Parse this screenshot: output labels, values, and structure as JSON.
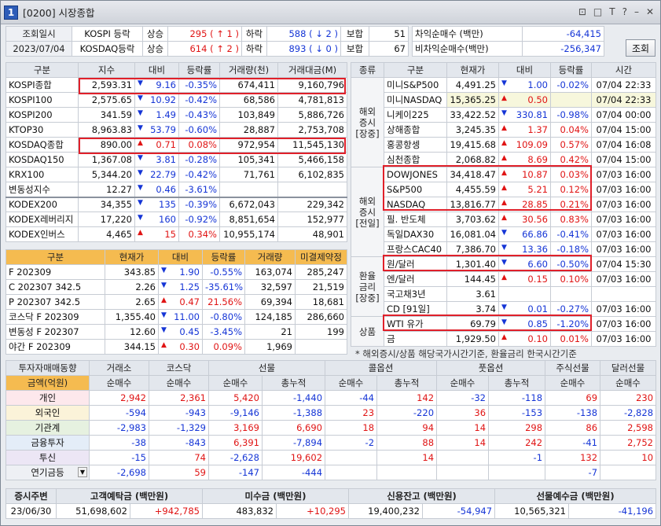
{
  "window": {
    "num": "1",
    "title": "[0200] 시장종합",
    "controls": [
      "⊡",
      "□",
      "T",
      "?",
      "–",
      "✕"
    ]
  },
  "top": {
    "label1": "조회일시",
    "date": "2023/07/04",
    "rows": [
      {
        "name": "KOSPI 등락",
        "up_l": "상승",
        "up_v": "295",
        "up_arrow": "↑",
        "up_n": "1",
        "dn_l": "하락",
        "dn_v": "588",
        "dn_arrow": "↓",
        "dn_n": "2",
        "flat_l": "보합",
        "flat_v": "51"
      },
      {
        "name": "KOSDAQ등락",
        "up_l": "상승",
        "up_v": "614",
        "up_arrow": "↑",
        "up_n": "2",
        "dn_l": "하락",
        "dn_v": "893",
        "dn_arrow": "↓",
        "dn_n": "0",
        "flat_l": "보합",
        "flat_v": "67"
      }
    ],
    "arb": [
      {
        "label": "차익순매수 (백만)",
        "value": "-64,415"
      },
      {
        "label": "비차익순매수(백만)",
        "value": "-256,347"
      }
    ],
    "query_button": "조회"
  },
  "idx": {
    "headers": [
      "구분",
      "지수",
      "대비",
      "등락률",
      "거래량(천)",
      "거래대금(M)"
    ],
    "rows": [
      {
        "n": "KOSPI종합",
        "v": "2,593.31",
        "a": "▼",
        "d": "9.16",
        "p": "-0.35%",
        "q": "674,411",
        "m": "9,160,796",
        "dir": "dn"
      },
      {
        "n": "KOSPI100",
        "v": "2,575.65",
        "a": "▼",
        "d": "10.92",
        "p": "-0.42%",
        "q": "68,586",
        "m": "4,781,813",
        "dir": "dn"
      },
      {
        "n": "KOSPI200",
        "v": "341.59",
        "a": "▼",
        "d": "1.49",
        "p": "-0.43%",
        "q": "103,849",
        "m": "5,886,726",
        "dir": "dn"
      },
      {
        "n": "KTOP30",
        "v": "8,963.83",
        "a": "▼",
        "d": "53.79",
        "p": "-0.60%",
        "q": "28,887",
        "m": "2,753,708",
        "dir": "dn"
      },
      {
        "n": "KOSDAQ종합",
        "v": "890.00",
        "a": "▲",
        "d": "0.71",
        "p": "0.08%",
        "q": "972,954",
        "m": "11,545,130",
        "dir": "up"
      },
      {
        "n": "KOSDAQ150",
        "v": "1,367.08",
        "a": "▼",
        "d": "3.81",
        "p": "-0.28%",
        "q": "105,341",
        "m": "5,466,158",
        "dir": "dn"
      },
      {
        "n": "KRX100",
        "v": "5,344.20",
        "a": "▼",
        "d": "22.79",
        "p": "-0.42%",
        "q": "71,761",
        "m": "6,102,835",
        "dir": "dn"
      },
      {
        "n": "변동성지수",
        "v": "12.27",
        "a": "▼",
        "d": "0.46",
        "p": "-3.61%",
        "q": "",
        "m": "",
        "dir": "dn"
      },
      {
        "n": "KODEX200",
        "v": "34,355",
        "a": "▼",
        "d": "135",
        "p": "-0.39%",
        "q": "6,672,043",
        "m": "229,342",
        "dir": "dn"
      },
      {
        "n": "KODEX레버리지",
        "v": "17,220",
        "a": "▼",
        "d": "160",
        "p": "-0.92%",
        "q": "8,851,654",
        "m": "152,977",
        "dir": "dn"
      },
      {
        "n": "KODEX인버스",
        "v": "4,465",
        "a": "▲",
        "d": "15",
        "p": "0.34%",
        "q": "10,955,174",
        "m": "48,901",
        "dir": "up"
      }
    ]
  },
  "fut": {
    "headers": [
      "구분",
      "현재가",
      "대비",
      "등락률",
      "거래량",
      "미결제약정"
    ],
    "rows": [
      {
        "n": "F 202309",
        "v": "343.85",
        "a": "▼",
        "d": "1.90",
        "p": "-0.55%",
        "q": "163,074",
        "m": "285,247",
        "dir": "dn"
      },
      {
        "n": "C 202307 342.5",
        "v": "2.26",
        "a": "▼",
        "d": "1.25",
        "p": "-35.61%",
        "q": "32,597",
        "m": "21,519",
        "dir": "dn"
      },
      {
        "n": "P 202307 342.5",
        "v": "2.65",
        "a": "▲",
        "d": "0.47",
        "p": "21.56%",
        "q": "69,394",
        "m": "18,681",
        "dir": "up"
      },
      {
        "n": "코스닥 F 202309",
        "v": "1,355.40",
        "a": "▼",
        "d": "11.00",
        "p": "-0.80%",
        "q": "124,185",
        "m": "286,660",
        "dir": "dn"
      },
      {
        "n": "변동성 F 202307",
        "v": "12.60",
        "a": "▼",
        "d": "0.45",
        "p": "-3.45%",
        "q": "21",
        "m": "199",
        "dir": "dn"
      },
      {
        "n": "야간 F 202309",
        "v": "344.15",
        "a": "▲",
        "d": "0.30",
        "p": "0.09%",
        "q": "1,969",
        "m": "",
        "dir": "up"
      }
    ]
  },
  "world": {
    "headers": [
      "종류",
      "구분",
      "현재가",
      "대비",
      "등락률",
      "시간"
    ],
    "groups": [
      {
        "label": "해외\n증시\n[장중]",
        "rows": [
          {
            "n": "미니S&P500",
            "v": "4,491.25",
            "a": "▼",
            "d": "1.00",
            "p": "-0.02%",
            "t": "07/04 22:33",
            "dir": "dn"
          },
          {
            "n": "미니NASDAQ",
            "v": "15,365.25",
            "a": "▲",
            "d": "0.50",
            "p": "",
            "t": "07/04 22:33",
            "dir": "up"
          },
          {
            "n": "니케이225",
            "v": "33,422.52",
            "a": "▼",
            "d": "330.81",
            "p": "-0.98%",
            "t": "07/04 00:00",
            "dir": "dn"
          },
          {
            "n": "상해종합",
            "v": "3,245.35",
            "a": "▲",
            "d": "1.37",
            "p": "0.04%",
            "t": "07/04 15:00",
            "dir": "up"
          },
          {
            "n": "홍콩항셍",
            "v": "19,415.68",
            "a": "▲",
            "d": "109.09",
            "p": "0.57%",
            "t": "07/04 16:08",
            "dir": "up"
          },
          {
            "n": "심천종합",
            "v": "2,068.82",
            "a": "▲",
            "d": "8.69",
            "p": "0.42%",
            "t": "07/04 15:00",
            "dir": "up"
          }
        ]
      },
      {
        "label": "해외\n증시\n[전일]",
        "rows": [
          {
            "n": "DOWJONES",
            "v": "34,418.47",
            "a": "▲",
            "d": "10.87",
            "p": "0.03%",
            "t": "07/03 16:00",
            "dir": "up"
          },
          {
            "n": "S&P500",
            "v": "4,455.59",
            "a": "▲",
            "d": "5.21",
            "p": "0.12%",
            "t": "07/03 16:00",
            "dir": "up"
          },
          {
            "n": "NASDAQ",
            "v": "13,816.77",
            "a": "▲",
            "d": "28.85",
            "p": "0.21%",
            "t": "07/03 16:00",
            "dir": "up"
          },
          {
            "n": "필. 반도체",
            "v": "3,703.62",
            "a": "▲",
            "d": "30.56",
            "p": "0.83%",
            "t": "07/03 16:00",
            "dir": "up"
          },
          {
            "n": "독일DAX30",
            "v": "16,081.04",
            "a": "▼",
            "d": "66.86",
            "p": "-0.41%",
            "t": "07/03 16:00",
            "dir": "dn"
          },
          {
            "n": "프랑스CAC40",
            "v": "7,386.70",
            "a": "▼",
            "d": "13.36",
            "p": "-0.18%",
            "t": "07/03 16:00",
            "dir": "dn"
          }
        ]
      },
      {
        "label": "환율\n금리\n[장중]",
        "rows": [
          {
            "n": "원/달러",
            "v": "1,301.40",
            "a": "▼",
            "d": "6.60",
            "p": "-0.50%",
            "t": "07/04 15:30",
            "dir": "dn"
          },
          {
            "n": "엔/달러",
            "v": "144.45",
            "a": "▲",
            "d": "0.15",
            "p": "0.10%",
            "t": "07/03 16:00",
            "dir": "up"
          },
          {
            "n": "국고채3년",
            "v": "3.61",
            "a": "",
            "d": "",
            "p": "",
            "t": "",
            "dir": "up"
          },
          {
            "n": "CD [91일]",
            "v": "3.74",
            "a": "▼",
            "d": "0.01",
            "p": "-0.27%",
            "t": "07/03 16:00",
            "dir": "dn"
          }
        ]
      },
      {
        "label": "상품",
        "rows": [
          {
            "n": "WTI 유가",
            "v": "69.79",
            "a": "▼",
            "d": "0.85",
            "p": "-1.20%",
            "t": "07/03 16:00",
            "dir": "dn"
          },
          {
            "n": "금",
            "v": "1,929.50",
            "a": "▲",
            "d": "0.10",
            "p": "0.01%",
            "t": "07/03 16:00",
            "dir": "up"
          }
        ]
      }
    ],
    "note": "* 해외증시/상품 해당국가시간기준, 환율금리 한국시간기준"
  },
  "inv": {
    "h1": [
      "투자자매매동향",
      "거래소",
      "코스닥",
      "선물",
      "콜옵션",
      "풋옵션",
      "주식선물",
      "달러선물"
    ],
    "h2": [
      "금액(억원)",
      "순매수",
      "순매수",
      "순매수",
      "총누적",
      "순매수",
      "총누적",
      "순매수",
      "총누적",
      "순매수",
      "순매수"
    ],
    "rows": [
      {
        "n": "개인",
        "v": [
          "2,942",
          "2,361",
          "5,420",
          "-1,440",
          "-44",
          "142",
          "-32",
          "-118",
          "69",
          "230"
        ],
        "d": [
          "up",
          "up",
          "up",
          "bl",
          "bl",
          "up",
          "bl",
          "bl",
          "up",
          "up"
        ]
      },
      {
        "n": "외국인",
        "v": [
          "-594",
          "-943",
          "-9,146",
          "-1,388",
          "23",
          "-220",
          "36",
          "-153",
          "-138",
          "-2,828"
        ],
        "d": [
          "bl",
          "bl",
          "bl",
          "bl",
          "up",
          "bl",
          "up",
          "bl",
          "bl",
          "bl"
        ]
      },
      {
        "n": "기관계",
        "v": [
          "-2,983",
          "-1,329",
          "3,169",
          "6,690",
          "18",
          "94",
          "14",
          "298",
          "86",
          "2,598"
        ],
        "d": [
          "bl",
          "bl",
          "up",
          "up",
          "up",
          "up",
          "up",
          "up",
          "up",
          "up"
        ]
      },
      {
        "n": "금융투자",
        "v": [
          "-38",
          "-843",
          "6,391",
          "-7,894",
          "-2",
          "88",
          "14",
          "242",
          "-41",
          "2,752"
        ],
        "d": [
          "bl",
          "bl",
          "up",
          "bl",
          "bl",
          "up",
          "up",
          "up",
          "bl",
          "up"
        ]
      },
      {
        "n": "투신",
        "v": [
          "-15",
          "74",
          "-2,628",
          "19,602",
          "",
          "14",
          "",
          "-1",
          "132",
          "10"
        ],
        "d": [
          "bl",
          "up",
          "bl",
          "up",
          "up",
          "up",
          "up",
          "bl",
          "up",
          "up"
        ]
      },
      {
        "n": "연기금등",
        "v": [
          "-2,698",
          "59",
          "-147",
          "-444",
          "",
          "",
          "",
          "",
          "-7",
          ""
        ],
        "d": [
          "bl",
          "up",
          "bl",
          "bl",
          "up",
          "up",
          "up",
          "up",
          "bl",
          "up"
        ]
      }
    ]
  },
  "bottom": {
    "h": [
      "증시주변",
      "고객예탁금 (백만원)",
      "미수금 (백만원)",
      "신용잔고 (백만원)",
      "선물예수금 (백만원)"
    ],
    "date": "23/06/30",
    "vals": [
      [
        "51,698,602",
        "+942,785",
        "up"
      ],
      [
        "483,832",
        "+10,295",
        "up"
      ],
      [
        "19,400,232",
        "-54,947",
        "bl"
      ],
      [
        "10,565,321",
        "-41,196",
        "bl"
      ]
    ]
  },
  "colors": {
    "up": "#e01414",
    "down": "#1535d6",
    "orange": "#f5bb50",
    "highlight": "#e0202a"
  }
}
